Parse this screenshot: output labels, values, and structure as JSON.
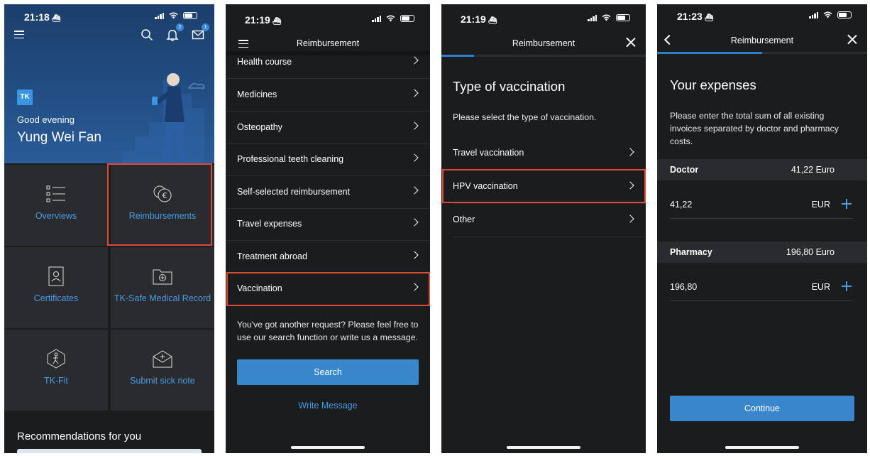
{
  "screen1": {
    "time": "21:18",
    "notif_badge": "2",
    "mail_badge": "1",
    "logo_text": "TK",
    "greeting": "Good evening",
    "user_name": "Yung Wei Fan",
    "tiles": [
      "Overviews",
      "Reimbursements",
      "Certificates",
      "TK-Safe Medical Record",
      "TK-Fit",
      "Submit sick note"
    ],
    "recommendations": "Recommendations for you"
  },
  "screen2": {
    "time": "21:19",
    "title": "Reimbursement",
    "items": [
      "Health course",
      "Medicines",
      "Osteopathy",
      "Professional teeth cleaning",
      "Self-selected reimbursement",
      "Travel expenses",
      "Treatment abroad",
      "Vaccination"
    ],
    "help_text": "You've got another request? Please feel free to use our search function or write us a message.",
    "search_button": "Search",
    "write_message": "Write Message"
  },
  "screen3": {
    "time": "21:19",
    "title": "Reimbursement",
    "progress": 0.16,
    "heading": "Type of vaccination",
    "instruction": "Please select the type of vaccination.",
    "options": [
      "Travel vaccination",
      "HPV vaccination",
      "Other"
    ]
  },
  "screen4": {
    "time": "21:23",
    "title": "Reimbursement",
    "progress": 0.5,
    "heading": "Your expenses",
    "instruction": "Please enter the total sum of all existing invoices separated by doctor and pharmacy costs.",
    "doctor": {
      "label": "Doctor",
      "total": "41,22 Euro",
      "value": "41,22",
      "currency": "EUR"
    },
    "pharmacy": {
      "label": "Pharmacy",
      "total": "196,80 Euro",
      "value": "196,80",
      "currency": "EUR"
    },
    "continue_button": "Continue"
  },
  "colors": {
    "accent": "#3a86cc",
    "highlight": "#e14a32",
    "background": "#1b1c1e"
  }
}
